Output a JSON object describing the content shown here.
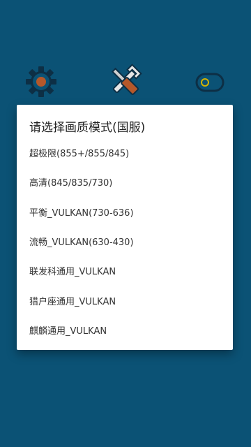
{
  "colors": {
    "background": "#0b5275",
    "dialog": "#ffffff",
    "title_text": "#222222",
    "option_text": "#333333"
  },
  "toolbar": {
    "icons": [
      "settings-gear-icon",
      "tools-icon",
      "toggle-switch-icon"
    ]
  },
  "dialog": {
    "title": "请选择画质模式(国服)",
    "options": [
      {
        "label": "超极限(855+/855/845)"
      },
      {
        "label": "高清(845/835/730)"
      },
      {
        "label": "平衡_VULKAN(730-636)"
      },
      {
        "label": "流畅_VULKAN(630-430)"
      },
      {
        "label": "联发科通用_VULKAN"
      },
      {
        "label": "猎户座通用_VULKAN"
      },
      {
        "label": "麒麟通用_VULKAN"
      }
    ]
  }
}
